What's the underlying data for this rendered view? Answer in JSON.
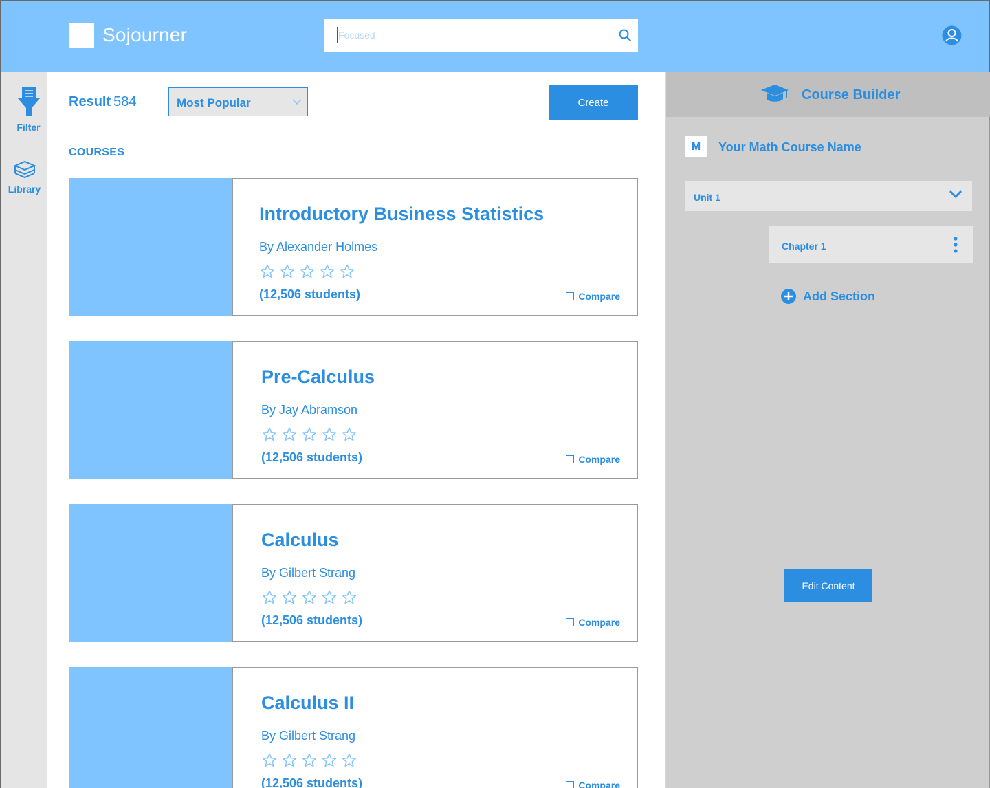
{
  "app": {
    "name": "Sojourner"
  },
  "search": {
    "placeholder": "Focused",
    "icon": "search-icon"
  },
  "header": {
    "user_icon": "user-icon"
  },
  "sidebar": {
    "items": [
      {
        "label": "Filter",
        "icon": "filter-icon"
      },
      {
        "label": "Library",
        "icon": "books-icon"
      }
    ]
  },
  "results": {
    "label": "Result",
    "count": "584"
  },
  "sort": {
    "selected": "Most Popular"
  },
  "toolbar": {
    "create_label": "Create"
  },
  "courses": {
    "section_title": "COURSES",
    "items": [
      {
        "title": "Introductory Business Statistics",
        "author": "By Alexander Holmes",
        "students": "(12,506 students)",
        "compare": "Compare",
        "rating": 0
      },
      {
        "title": "Pre-Calculus",
        "author": "By Jay Abramson",
        "students": "(12,506 students)",
        "compare": "Compare",
        "rating": 0
      },
      {
        "title": "Calculus",
        "author": "By Gilbert Strang",
        "students": "(12,506 students)",
        "compare": "Compare",
        "rating": 0
      },
      {
        "title": "Calculus II",
        "author": "By Gilbert Strang",
        "students": "(12,506 students)",
        "compare": "Compare",
        "rating": 0
      }
    ]
  },
  "builder": {
    "title": "Course Builder",
    "course_initial": "M",
    "course_name": "Your Math Course Name",
    "unit_label": "Unit 1",
    "chapter_label": "Chapter 1",
    "add_section_label": "Add Section",
    "edit_label": "Edit Content"
  },
  "colors": {
    "accent": "#2b8ee0",
    "header_bg": "#7fc3ff",
    "builder_bg": "#cfcfcf",
    "sidebar_bg": "#e5e5e5"
  }
}
